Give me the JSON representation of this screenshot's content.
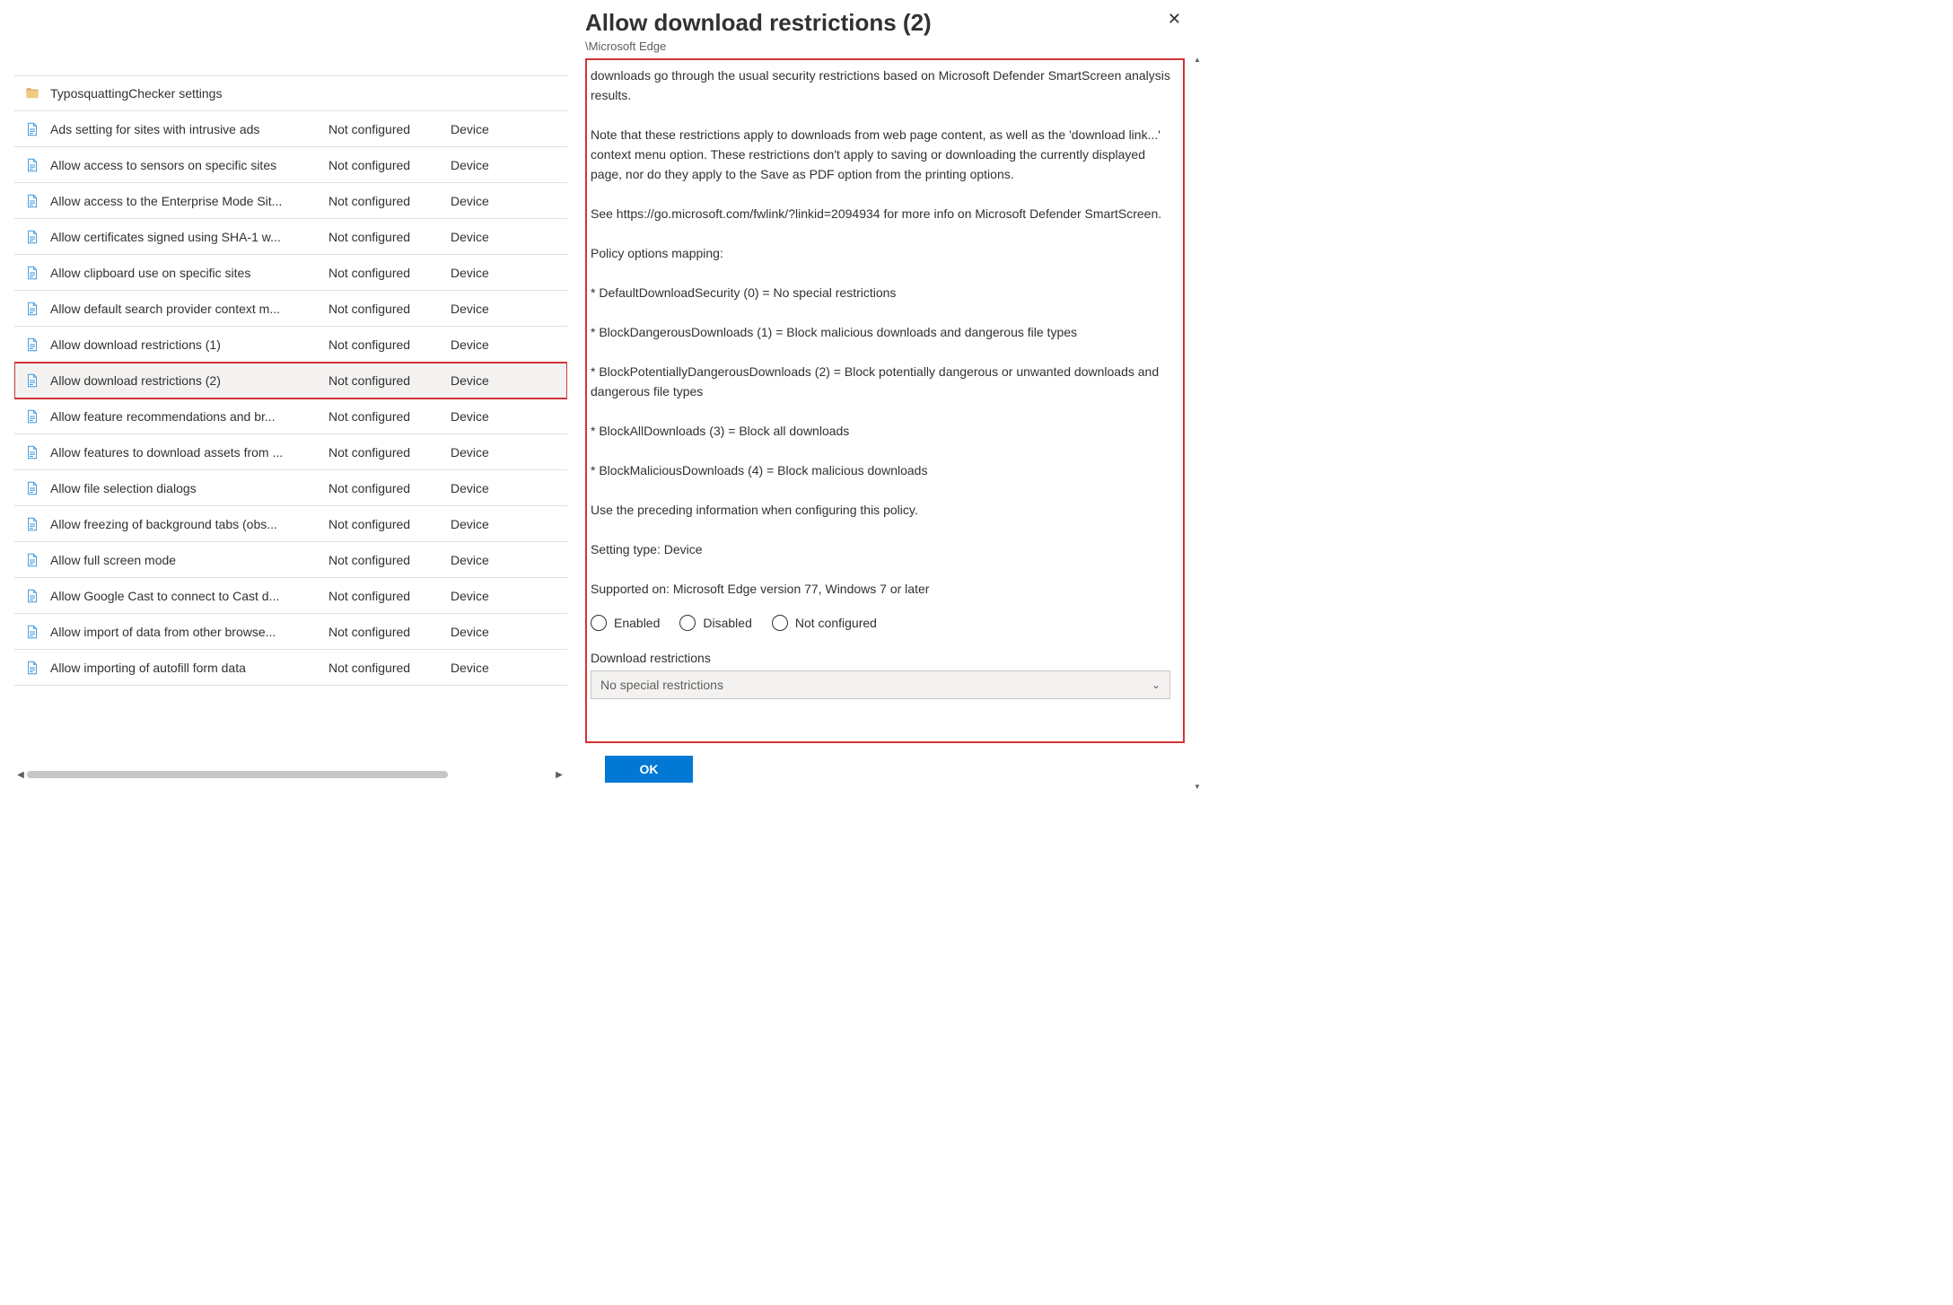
{
  "left": {
    "items": [
      {
        "type": "folder",
        "name": "TyposquattingChecker settings",
        "state": "",
        "scope": ""
      },
      {
        "type": "item",
        "name": "Ads setting for sites with intrusive ads",
        "state": "Not configured",
        "scope": "Device"
      },
      {
        "type": "item",
        "name": "Allow access to sensors on specific sites",
        "state": "Not configured",
        "scope": "Device"
      },
      {
        "type": "item",
        "name": "Allow access to the Enterprise Mode Sit...",
        "state": "Not configured",
        "scope": "Device"
      },
      {
        "type": "item",
        "name": "Allow certificates signed using SHA-1 w...",
        "state": "Not configured",
        "scope": "Device"
      },
      {
        "type": "item",
        "name": "Allow clipboard use on specific sites",
        "state": "Not configured",
        "scope": "Device"
      },
      {
        "type": "item",
        "name": "Allow default search provider context m...",
        "state": "Not configured",
        "scope": "Device"
      },
      {
        "type": "item",
        "name": "Allow download restrictions (1)",
        "state": "Not configured",
        "scope": "Device"
      },
      {
        "type": "item",
        "name": "Allow download restrictions (2)",
        "state": "Not configured",
        "scope": "Device",
        "selected": true
      },
      {
        "type": "item",
        "name": "Allow feature recommendations and br...",
        "state": "Not configured",
        "scope": "Device"
      },
      {
        "type": "item",
        "name": "Allow features to download assets from ...",
        "state": "Not configured",
        "scope": "Device"
      },
      {
        "type": "item",
        "name": "Allow file selection dialogs",
        "state": "Not configured",
        "scope": "Device"
      },
      {
        "type": "item",
        "name": "Allow freezing of background tabs (obs...",
        "state": "Not configured",
        "scope": "Device"
      },
      {
        "type": "item",
        "name": "Allow full screen mode",
        "state": "Not configured",
        "scope": "Device"
      },
      {
        "type": "item",
        "name": "Allow Google Cast to connect to Cast d...",
        "state": "Not configured",
        "scope": "Device"
      },
      {
        "type": "item",
        "name": "Allow import of data from other browse...",
        "state": "Not configured",
        "scope": "Device"
      },
      {
        "type": "item",
        "name": "Allow importing of autofill form data",
        "state": "Not configured",
        "scope": "Device"
      }
    ]
  },
  "right": {
    "title": "Allow download restrictions (2)",
    "breadcrumb": "\\Microsoft Edge",
    "description": "downloads go through the usual security restrictions based on Microsoft Defender SmartScreen analysis results.\n\nNote that these restrictions apply to downloads from web page content, as well as the 'download link...' context menu option. These restrictions don't apply to saving or downloading the currently displayed page, nor do they apply to the Save as PDF option from the printing options.\n\nSee https://go.microsoft.com/fwlink/?linkid=2094934 for more info on Microsoft Defender SmartScreen.\n\nPolicy options mapping:\n\n* DefaultDownloadSecurity (0) = No special restrictions\n\n* BlockDangerousDownloads (1) = Block malicious downloads and dangerous file types\n\n* BlockPotentiallyDangerousDownloads (2) = Block potentially dangerous or unwanted downloads and dangerous file types\n\n* BlockAllDownloads (3) = Block all downloads\n\n* BlockMaliciousDownloads (4) = Block malicious downloads\n\nUse the preceding information when configuring this policy.\n\nSetting type: Device\n\nSupported on: Microsoft Edge version 77, Windows 7 or later",
    "radios": {
      "enabled": "Enabled",
      "disabled": "Disabled",
      "notconfigured": "Not configured"
    },
    "field_label": "Download restrictions",
    "dropdown_value": "No special restrictions",
    "ok": "OK"
  }
}
